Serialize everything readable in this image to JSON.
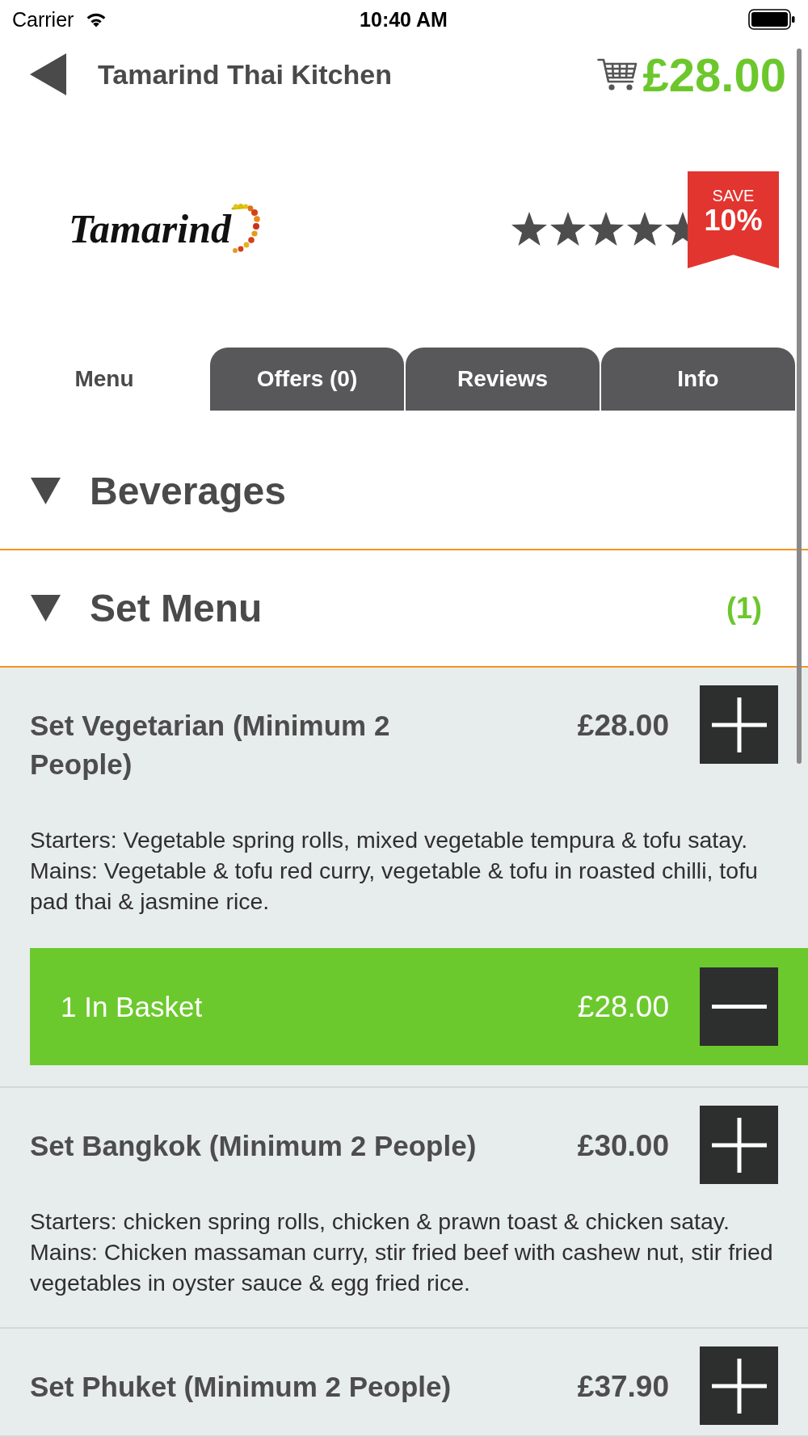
{
  "status_bar": {
    "carrier": "Carrier",
    "time": "10:40 AM"
  },
  "header": {
    "title": "Tamarind Thai Kitchen",
    "basket_total": "£28.00"
  },
  "restaurant": {
    "logo_text": "Tamarind",
    "stars": 5,
    "save_badge": {
      "label": "SAVE",
      "value": "10%"
    }
  },
  "tabs": [
    {
      "label": "Menu",
      "selected": true
    },
    {
      "label": "Offers (0)",
      "selected": false
    },
    {
      "label": "Reviews",
      "selected": false
    },
    {
      "label": "Info",
      "selected": false
    }
  ],
  "categories": [
    {
      "name": "Beverages"
    },
    {
      "name": "Set Menu",
      "count": "(1)",
      "items": [
        {
          "name": "Set Vegetarian (Minimum 2 People)",
          "price": "£28.00",
          "description": "Starters: Vegetable spring rolls, mixed vegetable tempura & tofu satay. Mains: Vegetable & tofu red curry, vegetable & tofu in roasted chilli, tofu pad thai & jasmine rice.",
          "basket": {
            "label": "1 In Basket",
            "price": "£28.00"
          }
        },
        {
          "name": "Set Bangkok (Minimum 2 People)",
          "price": "£30.00",
          "description": "Starters: chicken spring rolls, chicken & prawn toast & chicken satay. Mains: Chicken massaman curry, stir fried beef with cashew nut, stir fried vegetables in oyster sauce & egg fried rice."
        },
        {
          "name": "Set Phuket (Minimum 2 People)",
          "price": "£37.90"
        }
      ]
    }
  ]
}
